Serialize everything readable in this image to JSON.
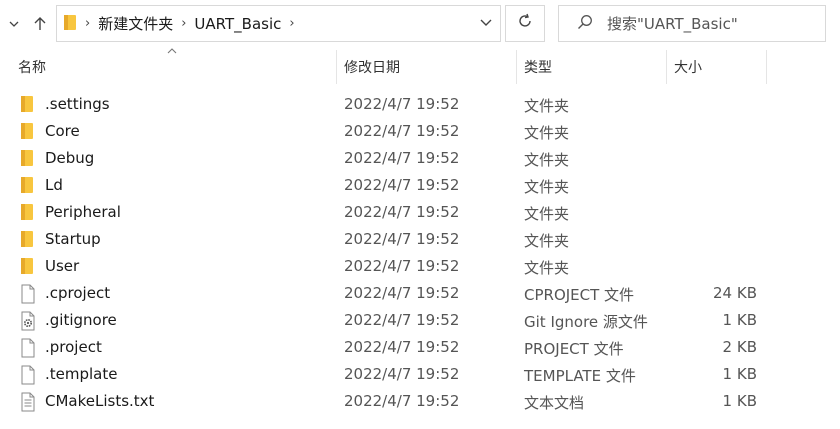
{
  "address": {
    "breadcrumbs": [
      "新建文件夹",
      "UART_Basic"
    ]
  },
  "search": {
    "placeholder": "搜索\"UART_Basic\""
  },
  "columns": {
    "name": "名称",
    "date": "修改日期",
    "type": "类型",
    "size": "大小"
  },
  "colors": {
    "folder": "#F8C63F",
    "border": "#D9D9D9"
  },
  "files": [
    {
      "name": ".settings",
      "date": "2022/4/7 19:52",
      "type": "文件夹",
      "size": "",
      "icon": "folder-icon"
    },
    {
      "name": "Core",
      "date": "2022/4/7 19:52",
      "type": "文件夹",
      "size": "",
      "icon": "folder-icon"
    },
    {
      "name": "Debug",
      "date": "2022/4/7 19:52",
      "type": "文件夹",
      "size": "",
      "icon": "folder-icon"
    },
    {
      "name": "Ld",
      "date": "2022/4/7 19:52",
      "type": "文件夹",
      "size": "",
      "icon": "folder-icon"
    },
    {
      "name": "Peripheral",
      "date": "2022/4/7 19:52",
      "type": "文件夹",
      "size": "",
      "icon": "folder-icon"
    },
    {
      "name": "Startup",
      "date": "2022/4/7 19:52",
      "type": "文件夹",
      "size": "",
      "icon": "folder-icon"
    },
    {
      "name": "User",
      "date": "2022/4/7 19:52",
      "type": "文件夹",
      "size": "",
      "icon": "folder-icon"
    },
    {
      "name": ".cproject",
      "date": "2022/4/7 19:52",
      "type": "CPROJECT 文件",
      "size": "24 KB",
      "icon": "file-icon"
    },
    {
      "name": ".gitignore",
      "date": "2022/4/7 19:52",
      "type": "Git Ignore 源文件",
      "size": "1 KB",
      "icon": "gear-file-icon"
    },
    {
      "name": ".project",
      "date": "2022/4/7 19:52",
      "type": "PROJECT 文件",
      "size": "2 KB",
      "icon": "file-icon"
    },
    {
      "name": ".template",
      "date": "2022/4/7 19:52",
      "type": "TEMPLATE 文件",
      "size": "1 KB",
      "icon": "file-icon"
    },
    {
      "name": "CMakeLists.txt",
      "date": "2022/4/7 19:52",
      "type": "文本文档",
      "size": "1 KB",
      "icon": "text-file-icon"
    }
  ]
}
